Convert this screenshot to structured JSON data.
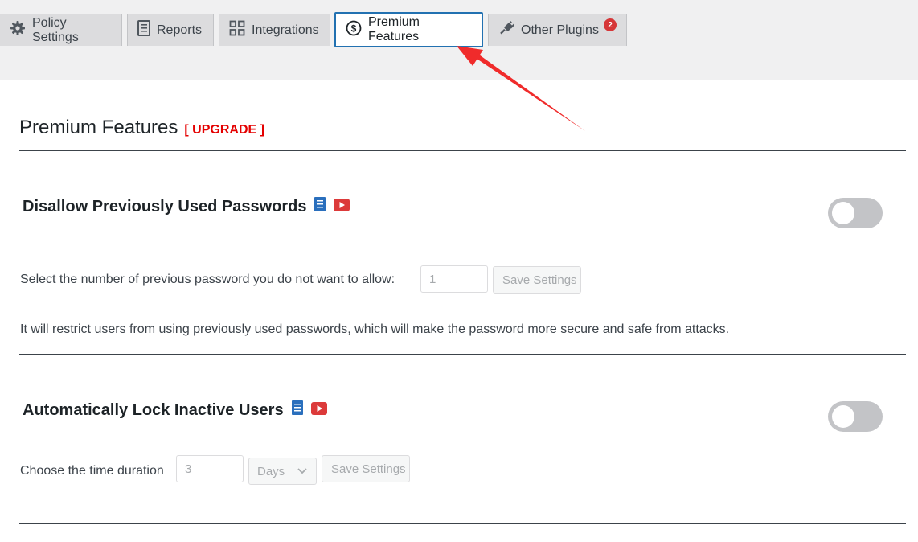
{
  "tabs": [
    {
      "label": "Policy Settings",
      "icon": "gear-icon"
    },
    {
      "label": "Reports",
      "icon": "document-icon"
    },
    {
      "label": "Integrations",
      "icon": "grid-icon"
    },
    {
      "label": "Premium Features",
      "icon": "dollar-circle-icon",
      "active": true
    },
    {
      "label": "Other Plugins",
      "icon": "plug-icon",
      "badge": "2"
    }
  ],
  "page": {
    "title": "Premium Features",
    "upgrade_label": "[ UPGRADE ]"
  },
  "sections": [
    {
      "title": "Disallow Previously Used Passwords",
      "toggle_on": false,
      "prompt": "Select the number of previous password you do not want to allow:",
      "input_value": "1",
      "save_label": "Save Settings",
      "description": "It will restrict users from using previously used passwords, which will make the password more secure and safe from attacks."
    },
    {
      "title": "Automatically Lock Inactive Users",
      "toggle_on": false,
      "prompt": "Choose the time duration",
      "input_value": "3",
      "unit_selected": "Days",
      "save_label": "Save Settings"
    }
  ],
  "colors": {
    "accent": "#2271b1",
    "upgrade": "#e40000",
    "badge": "#d63638",
    "toggle_off": "#c3c4c7",
    "arrow": "#f02b2b"
  }
}
